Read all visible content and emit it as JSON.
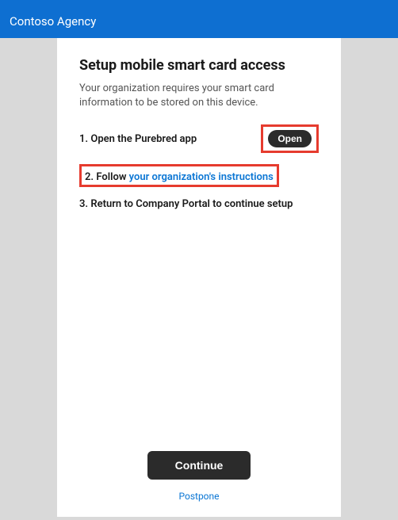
{
  "header": {
    "org_name": "Contoso Agency"
  },
  "main": {
    "title": "Setup mobile smart card access",
    "subtitle": "Your organization requires your smart card information to be stored on this device.",
    "steps": {
      "step1": {
        "text": "1.  Open the Purebred app",
        "action_label": "Open"
      },
      "step2": {
        "prefix": "2.  Follow ",
        "link_text": "your organization's instructions"
      },
      "step3": {
        "text": "3.  Return to Company Portal to continue setup"
      }
    }
  },
  "footer": {
    "continue_label": "Continue",
    "postpone_label": "Postpone"
  },
  "colors": {
    "header_bg": "#0e6fd1",
    "highlight_border": "#e63b2e",
    "link": "#0b76d4",
    "pill_bg": "#2b2b2b"
  }
}
